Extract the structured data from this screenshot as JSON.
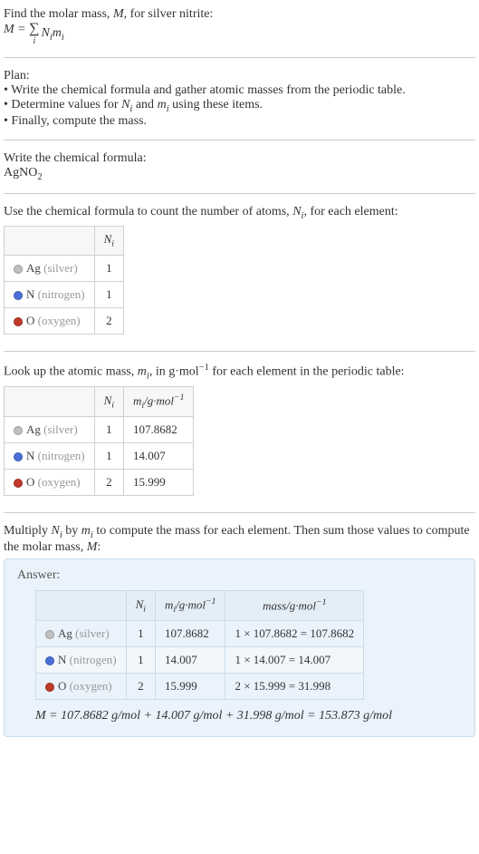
{
  "header": {
    "line1_prefix": "Find the molar mass, ",
    "line1_var": "M",
    "line1_suffix": ", for silver nitrite:",
    "formula_lhs": "M",
    "formula_eq": " = ",
    "sum_index": "i",
    "sum_rhs_N": "N",
    "sum_rhs_N_i": "i",
    "sum_rhs_m": "m",
    "sum_rhs_m_i": "i"
  },
  "plan": {
    "title": "Plan:",
    "b1": "• Write the chemical formula and gather atomic masses from the periodic table.",
    "b2_prefix": "• Determine values for ",
    "b2_N": "N",
    "b2_Ni": "i",
    "b2_and": " and ",
    "b2_m": "m",
    "b2_mi": "i",
    "b2_suffix": " using these items.",
    "b3": "• Finally, compute the mass."
  },
  "chem": {
    "title": "Write the chemical formula:",
    "formula_base": "AgNO",
    "formula_sub": "2"
  },
  "count": {
    "intro_prefix": "Use the chemical formula to count the number of atoms, ",
    "intro_N": "N",
    "intro_Ni": "i",
    "intro_suffix": ", for each element:",
    "header_empty": "",
    "header_N": "N",
    "header_Ni": "i",
    "rows": [
      {
        "color": "#c0c0c0",
        "sym": "Ag",
        "name": "(silver)",
        "n": "1"
      },
      {
        "color": "#4a6fd8",
        "sym": "N",
        "name": "(nitrogen)",
        "n": "1"
      },
      {
        "color": "#c0392b",
        "sym": "O",
        "name": "(oxygen)",
        "n": "2"
      }
    ]
  },
  "mass": {
    "intro_prefix": "Look up the atomic mass, ",
    "intro_m": "m",
    "intro_mi": "i",
    "intro_mid": ", in g·mol",
    "intro_exp": "−1",
    "intro_suffix": " for each element in the periodic table:",
    "header_N": "N",
    "header_Ni": "i",
    "header_m": "m",
    "header_mi": "i",
    "header_unit_prefix": "/g·mol",
    "header_unit_exp": "−1",
    "rows": [
      {
        "color": "#c0c0c0",
        "sym": "Ag",
        "name": "(silver)",
        "n": "1",
        "m": "107.8682"
      },
      {
        "color": "#4a6fd8",
        "sym": "N",
        "name": "(nitrogen)",
        "n": "1",
        "m": "14.007"
      },
      {
        "color": "#c0392b",
        "sym": "O",
        "name": "(oxygen)",
        "n": "2",
        "m": "15.999"
      }
    ]
  },
  "compute": {
    "line_prefix": "Multiply ",
    "line_N": "N",
    "line_Ni": "i",
    "line_by": " by ",
    "line_m": "m",
    "line_mi": "i",
    "line_suffix1": " to compute the mass for each element. Then sum those values to compute the molar mass, ",
    "line_M": "M",
    "line_suffix2": ":"
  },
  "answer": {
    "title": "Answer:",
    "header_N": "N",
    "header_Ni": "i",
    "header_m": "m",
    "header_mi": "i",
    "header_m_unit_prefix": "/g·mol",
    "header_m_unit_exp": "−1",
    "header_mass_prefix": "mass/g·mol",
    "header_mass_exp": "−1",
    "rows": [
      {
        "color": "#c0c0c0",
        "sym": "Ag",
        "name": "(silver)",
        "n": "1",
        "m": "107.8682",
        "calc": "1 × 107.8682 = 107.8682"
      },
      {
        "color": "#4a6fd8",
        "sym": "N",
        "name": "(nitrogen)",
        "n": "1",
        "m": "14.007",
        "calc": "1 × 14.007 = 14.007"
      },
      {
        "color": "#c0392b",
        "sym": "O",
        "name": "(oxygen)",
        "n": "2",
        "m": "15.999",
        "calc": "2 × 15.999 = 31.998"
      }
    ],
    "final": "M = 107.8682 g/mol + 14.007 g/mol + 31.998 g/mol = 153.873 g/mol"
  },
  "chart_data": {
    "type": "table",
    "title": "Molar mass of silver nitrite (AgNO2)",
    "columns": [
      "element",
      "atom_count_N_i",
      "atomic_mass_m_i_g_per_mol",
      "mass_contribution_g_per_mol"
    ],
    "rows": [
      {
        "element": "Ag (silver)",
        "atom_count_N_i": 1,
        "atomic_mass_m_i_g_per_mol": 107.8682,
        "mass_contribution_g_per_mol": 107.8682
      },
      {
        "element": "N (nitrogen)",
        "atom_count_N_i": 1,
        "atomic_mass_m_i_g_per_mol": 14.007,
        "mass_contribution_g_per_mol": 14.007
      },
      {
        "element": "O (oxygen)",
        "atom_count_N_i": 2,
        "atomic_mass_m_i_g_per_mol": 15.999,
        "mass_contribution_g_per_mol": 31.998
      }
    ],
    "total_molar_mass_g_per_mol": 153.873
  }
}
